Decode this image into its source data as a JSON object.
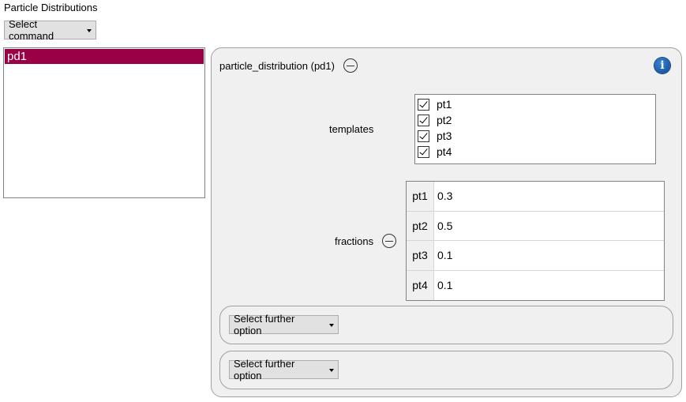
{
  "page": {
    "title": "Particle Distributions"
  },
  "toolbar": {
    "select_command_label": "Select command"
  },
  "list": {
    "items": [
      {
        "label": "pd1",
        "selected": true
      }
    ]
  },
  "panel": {
    "title": "particle_distribution (pd1)",
    "templates_label": "templates",
    "templates": [
      {
        "label": "pt1",
        "checked": true
      },
      {
        "label": "pt2",
        "checked": true
      },
      {
        "label": "pt3",
        "checked": true
      },
      {
        "label": "pt4",
        "checked": true
      }
    ],
    "fractions_label": "fractions",
    "fractions": [
      {
        "key": "pt1",
        "value": "0.3"
      },
      {
        "key": "pt2",
        "value": "0.5"
      },
      {
        "key": "pt3",
        "value": "0.1"
      },
      {
        "key": "pt4",
        "value": "0.1"
      }
    ],
    "further_options": [
      {
        "label": "Select further option"
      },
      {
        "label": "Select further option"
      }
    ]
  },
  "icons": {
    "collapse": "minus-circle-icon",
    "info": "info-icon",
    "dropdown": "caret-down-icon",
    "check": "checkmark-icon"
  },
  "colors": {
    "selection": "#990045",
    "panel_bg": "#f0f0f0",
    "info_blue": "#1f5fae"
  }
}
